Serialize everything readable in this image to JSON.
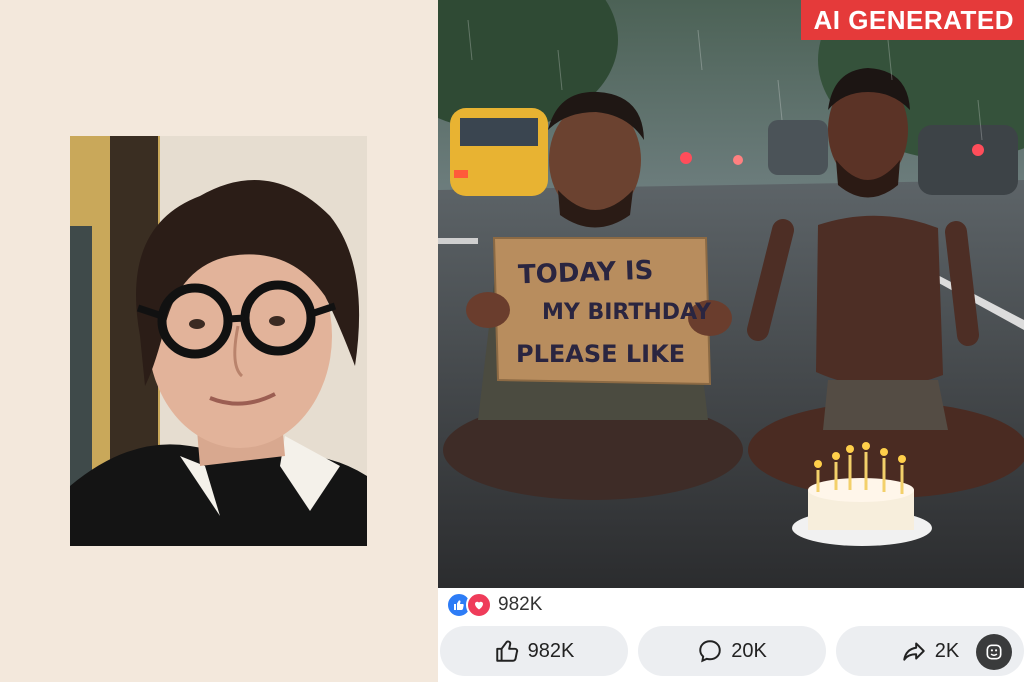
{
  "post_image": {
    "badge": "AI GENERATED",
    "sign_lines": [
      "TODAY IS",
      "MY BIRTHDAY",
      "PLEASE LIKE"
    ]
  },
  "reactions": {
    "icons": [
      "like-icon",
      "love-icon"
    ],
    "total": "982K"
  },
  "actions": {
    "like": {
      "count": "982K",
      "icon": "thumbs-up-icon"
    },
    "comment": {
      "count": "20K",
      "icon": "comment-bubble-icon"
    },
    "share": {
      "count": "2K",
      "icon": "share-arrow-icon"
    }
  },
  "colors": {
    "badge_bg": "#e53a3a",
    "like_blue": "#2d7cf6",
    "love_red": "#ef3c5a",
    "button_bg": "#eceef1"
  }
}
